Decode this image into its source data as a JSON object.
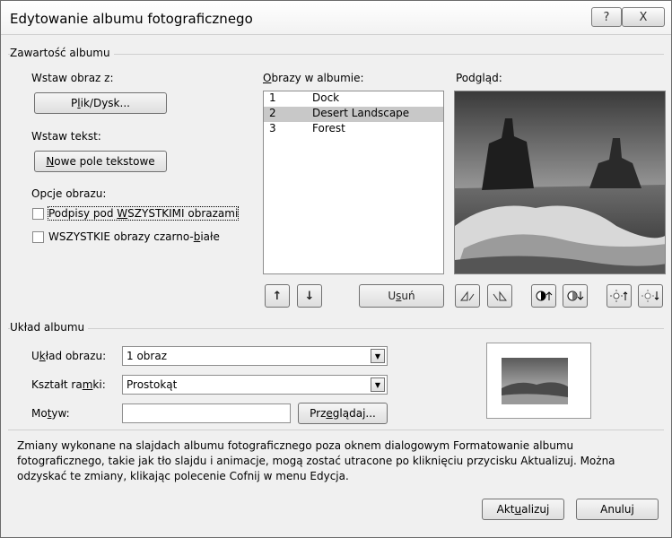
{
  "window": {
    "title": "Edytowanie albumu fotograficznego",
    "help_glyph": "?",
    "close_glyph": "X"
  },
  "content_group": {
    "label": "Zawartość albumu"
  },
  "insert_picture": {
    "label": "Wstaw obraz z:",
    "button_prefix": "P",
    "button_underlined": "l",
    "button_suffix": "ik/Dysk..."
  },
  "insert_text": {
    "label": "Wstaw tekst:",
    "button_underlined": "N",
    "button_suffix": "owe pole tekstowe"
  },
  "picture_options": {
    "label": "Opcje obrazu:",
    "captions": {
      "prefix": "Podpisy pod ",
      "underlined": "W",
      "suffix": "SZYSTKIMI obrazami",
      "checked": false
    },
    "black_white": {
      "prefix": "WSZYSTKIE obrazy czarno-",
      "underlined": "b",
      "suffix": "iałe",
      "checked": false
    }
  },
  "album_pictures": {
    "label_underlined": "O",
    "label_suffix": "brazy w albumie:",
    "items": [
      {
        "num": "1",
        "name": "Dock",
        "selected": false
      },
      {
        "num": "2",
        "name": "Desert Landscape",
        "selected": true
      },
      {
        "num": "3",
        "name": "Forest",
        "selected": false
      }
    ],
    "up_glyph": "↑",
    "down_glyph": "↓",
    "remove_prefix": "U",
    "remove_underlined": "s",
    "remove_suffix": "uń"
  },
  "preview": {
    "label": "Podgląd:",
    "tool_icons": [
      "rotate-left-icon",
      "rotate-right-icon",
      "contrast-up-icon",
      "contrast-down-icon",
      "brightness-up-icon",
      "brightness-down-icon"
    ]
  },
  "layout_group": {
    "label": "Układ albumu",
    "picture_layout": {
      "label_prefix": "U",
      "label_underlined": "k",
      "label_suffix": "ład obrazu:",
      "value": "1 obraz"
    },
    "frame_shape": {
      "label_prefix": "Kształt ra",
      "label_underlined": "m",
      "label_suffix": "ki:",
      "value": "Prostokąt"
    },
    "theme": {
      "label_prefix": "Mo",
      "label_underlined": "t",
      "label_suffix": "yw:",
      "value": "",
      "browse_prefix": "Prz",
      "browse_underlined": "e",
      "browse_suffix": "glądaj..."
    }
  },
  "info_text": "Zmiany wykonane na slajdach albumu fotograficznego poza oknem dialogowym Formatowanie albumu fotograficznego, takie jak tło slajdu i animacje, mogą zostać utracone po kliknięciu przycisku Aktualizuj. Można odzyskać te zmiany, klikając polecenie Cofnij w menu Edycja.",
  "footer": {
    "update_prefix": "Akt",
    "update_underlined": "u",
    "update_suffix": "alizuj",
    "cancel": "Anuluj"
  }
}
